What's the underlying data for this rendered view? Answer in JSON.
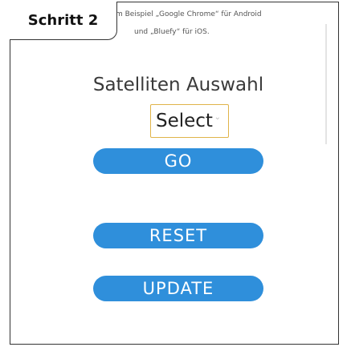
{
  "step": {
    "label": "Schritt 2"
  },
  "hint": {
    "line1": "m Beispiel „Google Chrome“ für Android",
    "line2": "und „Bluefy“ für iOS."
  },
  "page": {
    "title": "Satelliten Auswahl"
  },
  "satellite_select": {
    "selected": "Select",
    "chevron_icon": "chevron-down-icon"
  },
  "buttons": {
    "go": "GO",
    "reset": "RESET",
    "update": "UPDATE"
  },
  "colors": {
    "button_bg": "#2f8fdb",
    "select_border": "#e0b44a",
    "frame": "#333333"
  }
}
